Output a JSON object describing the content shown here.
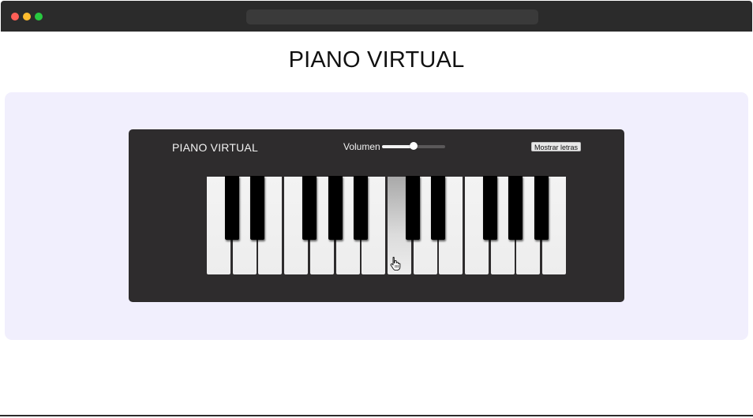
{
  "page": {
    "title": "PIANO VIRTUAL"
  },
  "piano": {
    "title": "PIANO VIRTUAL",
    "volume_label": "Volumen",
    "volume_level": 0.5,
    "show_letters_label": "Mostrar letras",
    "active_white_key_index": 7,
    "white_key_count": 14,
    "black_key_positions_after_white": [
      0,
      1,
      3,
      4,
      5,
      7,
      8,
      10,
      11,
      12
    ]
  },
  "colors": {
    "titlebar": "#2b2b2b",
    "stage_background": "#f1effd",
    "piano_body": "#2e2c2d",
    "white_key": "#ededed",
    "black_key": "#000000"
  },
  "icons": {
    "cursor": "hand-pointer-icon"
  }
}
